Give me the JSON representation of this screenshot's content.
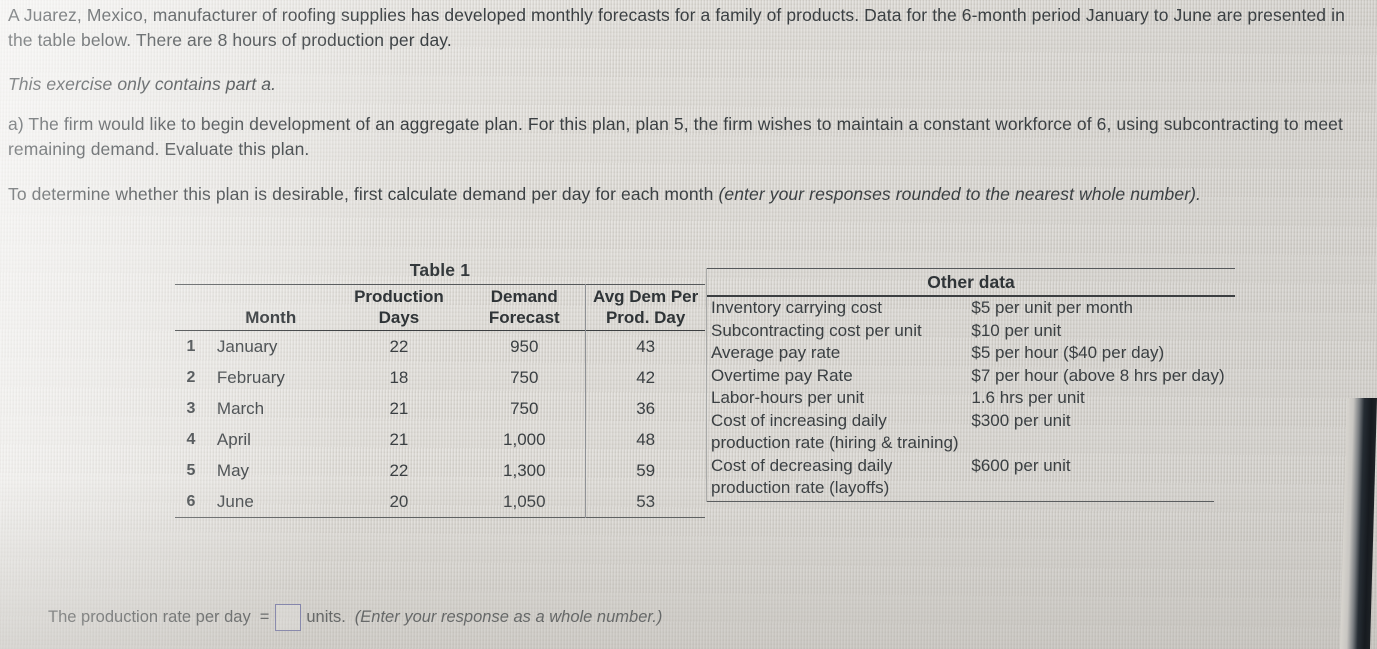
{
  "problem": {
    "paragraph_1": "A Juarez, Mexico, manufacturer of roofing supplies has developed monthly forecasts for a family of products. Data for the 6-month period January to June are presented in the table below. There are 8 hours of production per day.",
    "paragraph_2": "This exercise only contains part a.",
    "paragraph_3": "a) The firm would like to begin development of an aggregate plan. For this plan, plan 5, the firm wishes to maintain a constant workforce of 6, using subcontracting to meet remaining demand. Evaluate this plan.",
    "paragraph_4_main": "To determine whether this plan is desirable, first calculate demand per day for each month ",
    "paragraph_4_italic": "(enter your responses rounded to the nearest whole number)."
  },
  "table1": {
    "caption": "Table 1",
    "headers": {
      "index": "",
      "month": "Month",
      "production_days": "Production Days",
      "production_days_line1": "Production",
      "production_days_line2": "Days",
      "demand_forecast_line1": "Demand",
      "demand_forecast_line2": "Forecast",
      "avg_dem_line1": "Avg Dem Per",
      "avg_dem_line2": "Prod. Day"
    },
    "rows": [
      {
        "index": "1",
        "month": "January",
        "production_days": "22",
        "demand_forecast": "950",
        "avg_dem_per_prod_day": "43"
      },
      {
        "index": "2",
        "month": "February",
        "production_days": "18",
        "demand_forecast": "750",
        "avg_dem_per_prod_day": "42"
      },
      {
        "index": "3",
        "month": "March",
        "production_days": "21",
        "demand_forecast": "750",
        "avg_dem_per_prod_day": "36"
      },
      {
        "index": "4",
        "month": "April",
        "production_days": "21",
        "demand_forecast": "1,000",
        "avg_dem_per_prod_day": "48"
      },
      {
        "index": "5",
        "month": "May",
        "production_days": "22",
        "demand_forecast": "1,300",
        "avg_dem_per_prod_day": "59"
      },
      {
        "index": "6",
        "month": "June",
        "production_days": "20",
        "demand_forecast": "1,050",
        "avg_dem_per_prod_day": "53"
      }
    ]
  },
  "other_data": {
    "title": "Other data",
    "rows": [
      {
        "label": "Inventory carrying cost",
        "value": "$5 per unit per month"
      },
      {
        "label": "Subcontracting cost per unit",
        "value": "$10 per unit"
      },
      {
        "label": "Average pay rate",
        "value": "$5 per hour ($40 per day)"
      },
      {
        "label": "Overtime pay Rate",
        "value": "$7 per hour (above 8 hrs per day)"
      },
      {
        "label": "Labor-hours per unit",
        "value": "1.6 hrs per unit"
      },
      {
        "label": "Cost of increasing daily production rate (hiring & training)",
        "value": "$300 per unit"
      },
      {
        "label": "Cost of decreasing daily production rate (layoffs)",
        "value": "$600 per unit"
      }
    ]
  },
  "answer": {
    "prompt": "The production rate per day",
    "equals": "=",
    "input_value": "",
    "unit": "units.",
    "hint": "(Enter your response as a whole number.)"
  },
  "colors": {
    "page_background": "#d9d6d0",
    "text": "#3b4043",
    "rule": "#55585a",
    "input_border": "#6b6ea8",
    "bezel": "#1a1e23"
  }
}
